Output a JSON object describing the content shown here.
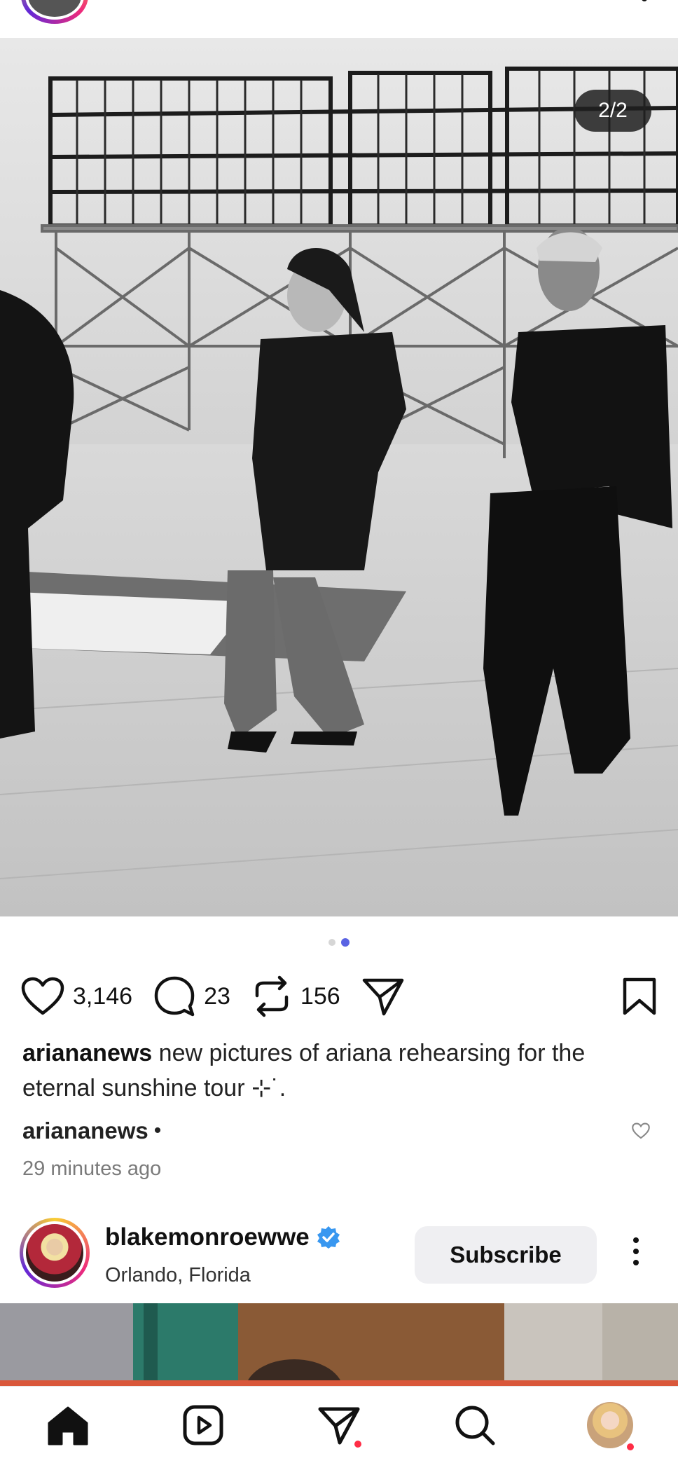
{
  "photo": {
    "counter": "2/2",
    "alt": "",
    "carousel_total": 2,
    "carousel_active_index": 1
  },
  "actions": {
    "likes": "3,146",
    "comments": "23",
    "reposts": "156"
  },
  "caption": {
    "username": "ariananews",
    "text": " new pictures of ariana rehearsing for the eternal sunshine tour ⊹˙."
  },
  "reply": {
    "username": "ariananews",
    "bullet": "•"
  },
  "timestamp": "29 minutes ago",
  "next_post": {
    "username": "blakemonroewwe",
    "location": "Orlando, Florida",
    "subscribe_label": "Subscribe"
  },
  "colors": {
    "accent": "#5a63e3",
    "verified": "#3897f0",
    "badge": "#ff2d46"
  },
  "icons": {
    "nav": [
      "home-icon",
      "reels-icon",
      "send-icon",
      "search-icon",
      "profile-avatar"
    ]
  }
}
